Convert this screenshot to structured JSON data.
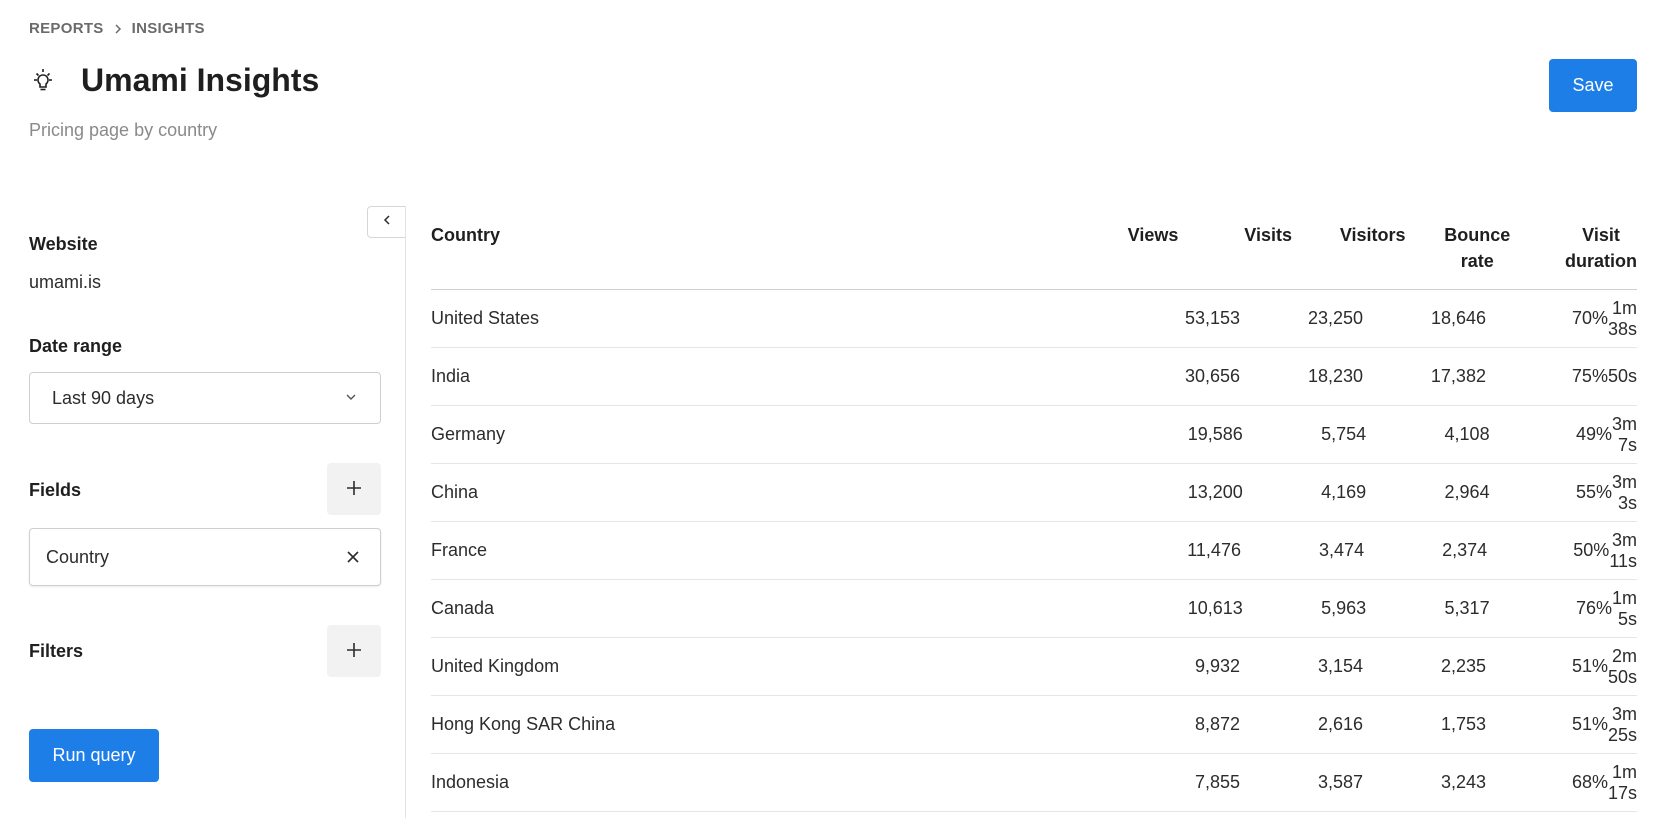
{
  "breadcrumb": {
    "items": [
      "REPORTS",
      "INSIGHTS"
    ]
  },
  "header": {
    "title": "Umami Insights",
    "description": "Pricing page by country",
    "save_label": "Save",
    "title_icon": "lightbulb-icon"
  },
  "sidebar": {
    "website_label": "Website",
    "website_value": "umami.is",
    "date_range_label": "Date range",
    "date_range_value": "Last 90 days",
    "fields_label": "Fields",
    "fields": [
      "Country"
    ],
    "filters_label": "Filters",
    "run_label": "Run query"
  },
  "table": {
    "columns": [
      "Country",
      "Views",
      "Visits",
      "Visitors",
      "Bounce rate",
      "Visit duration"
    ],
    "rows": [
      [
        "United States",
        "53,153",
        "23,250",
        "18,646",
        "70%",
        "1m 38s"
      ],
      [
        "India",
        "30,656",
        "18,230",
        "17,382",
        "75%",
        "50s"
      ],
      [
        "Germany",
        "19,586",
        "5,754",
        "4,108",
        "49%",
        "3m 7s"
      ],
      [
        "China",
        "13,200",
        "4,169",
        "2,964",
        "55%",
        "3m 3s"
      ],
      [
        "France",
        "11,476",
        "3,474",
        "2,374",
        "50%",
        "3m 11s"
      ],
      [
        "Canada",
        "10,613",
        "5,963",
        "5,317",
        "76%",
        "1m 5s"
      ],
      [
        "United Kingdom",
        "9,932",
        "3,154",
        "2,235",
        "51%",
        "2m 50s"
      ],
      [
        "Hong Kong SAR China",
        "8,872",
        "2,616",
        "1,753",
        "51%",
        "3m 25s"
      ],
      [
        "Indonesia",
        "7,855",
        "3,587",
        "3,243",
        "68%",
        "1m 17s"
      ]
    ]
  },
  "colors": {
    "primary": "#1d7ee8",
    "text": "#2c2c2c",
    "muted": "#8a8a8a"
  }
}
